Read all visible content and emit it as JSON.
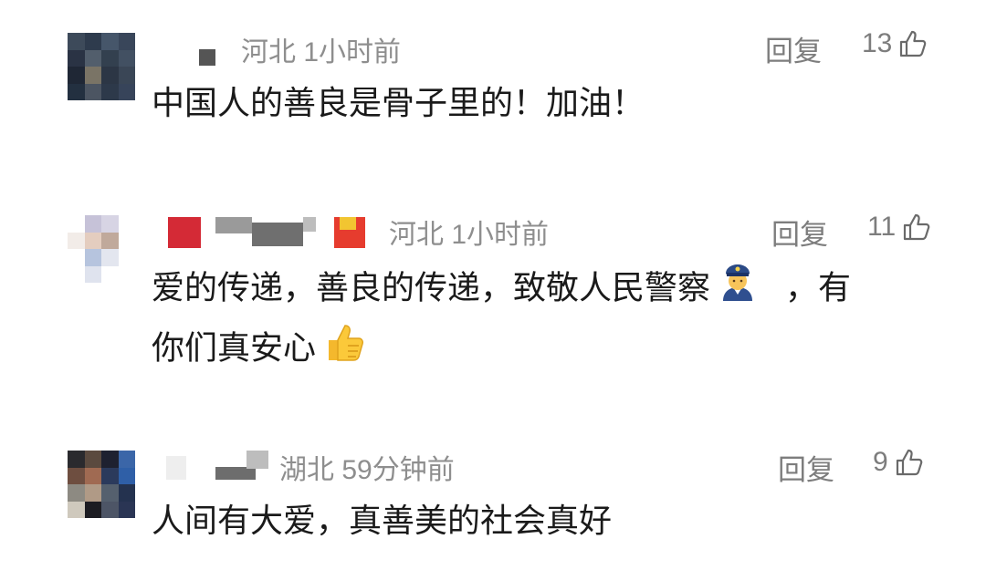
{
  "comments": [
    {
      "location": "河北",
      "time": "1小时前",
      "reply_label": "回复",
      "like_count": "13",
      "text_lines": [
        "中国人的善良是骨子里的！加油！"
      ]
    },
    {
      "location": "河北",
      "time": "1小时前",
      "reply_label": "回复",
      "like_count": "11",
      "text_line1_a": "爱的传递，善良的传递，致敬人民警察",
      "text_line1_b": "，有",
      "text_line2": "你们真安心"
    },
    {
      "location": "湖北",
      "time": "59分钟前",
      "reply_label": "回复",
      "like_count": "9",
      "text_lines": [
        "人间有大爱，真善美的社会真好"
      ]
    }
  ],
  "icons": {
    "like": "thumbs-up-outline-icon",
    "police": "police-officer-emoji",
    "thumbs_up_emoji": "thumbs-up-emoji"
  }
}
